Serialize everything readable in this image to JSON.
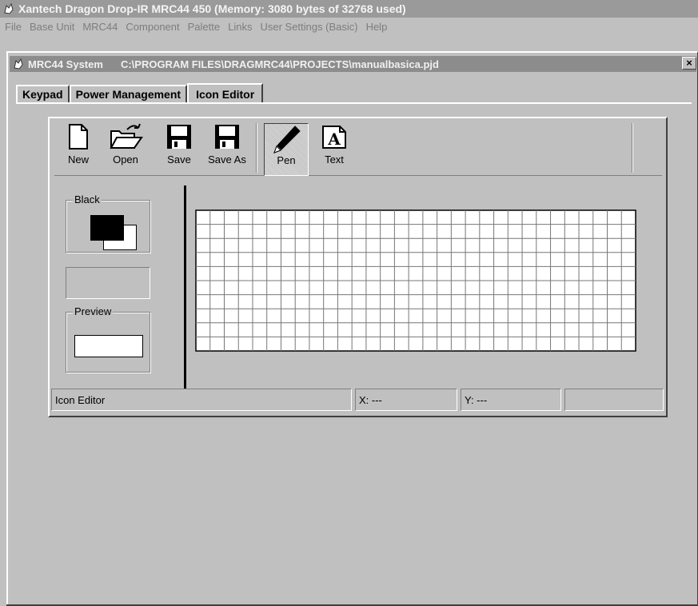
{
  "app": {
    "title": "Xantech Dragon Drop-IR MRC44 450 (Memory: 3080 bytes of 32768 used)"
  },
  "menu": {
    "items": [
      "File",
      "Base Unit",
      "MRC44",
      "Component",
      "Palette",
      "Links",
      "User Settings (Basic)",
      "Help"
    ]
  },
  "window": {
    "system_label": "MRC44 System",
    "path": "C:\\PROGRAM FILES\\DRAGMRC44\\PROJECTS\\manualbasica.pjd",
    "close_label": "×"
  },
  "tabs": [
    {
      "label": "Keypad"
    },
    {
      "label": "Power Management"
    },
    {
      "label": "Icon Editor",
      "active": true
    }
  ],
  "toolbar": {
    "buttons": [
      {
        "label": "New",
        "icon": "new-file-icon"
      },
      {
        "label": "Open",
        "icon": "open-folder-icon"
      },
      {
        "label": "Save",
        "icon": "floppy-disk-icon"
      },
      {
        "label": "Save As",
        "icon": "floppy-disk-icon"
      },
      {
        "label": "Pen",
        "icon": "pen-icon",
        "pressed": true
      },
      {
        "label": "Text",
        "icon": "text-tool-icon"
      }
    ]
  },
  "color_panel": {
    "title": "Black",
    "foreground": "#000000",
    "background": "#ffffff"
  },
  "preview": {
    "title": "Preview"
  },
  "grid": {
    "columns": 31,
    "rows": 10
  },
  "status": {
    "mode": "Icon Editor",
    "x": "X: ---",
    "y": "Y: ---"
  }
}
